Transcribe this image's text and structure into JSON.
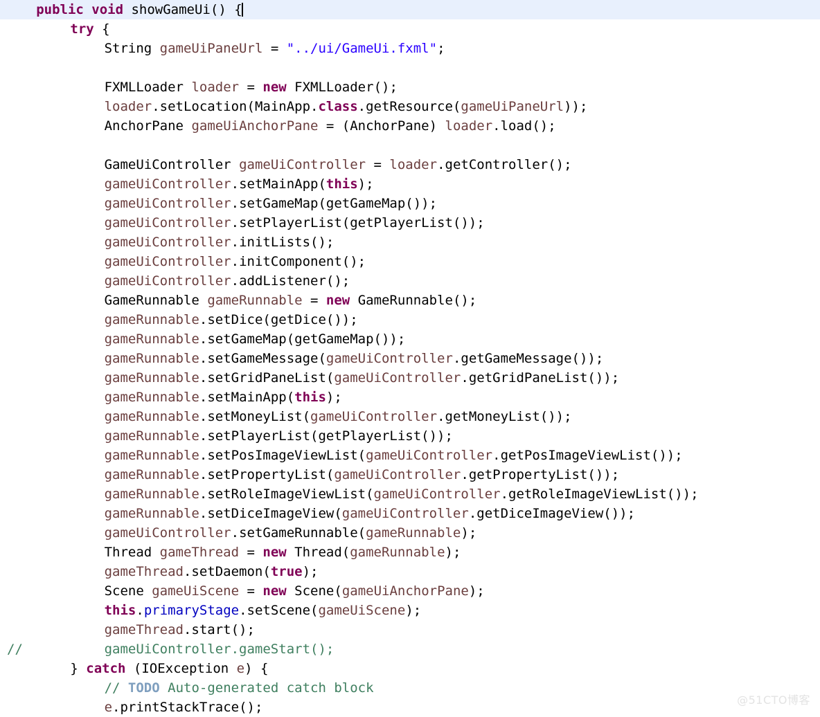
{
  "editor": {
    "language": "java",
    "font_size_px": 19,
    "line_height_px": 28,
    "current_line_index": 0,
    "caret_line": 0,
    "colors": {
      "background": "#ffffff",
      "current_line_highlight": "#e8f0fd",
      "keyword": "#7f0055",
      "type": "#000000",
      "local_variable": "#6a3e3e",
      "field": "#0000c0",
      "string": "#2a00ff",
      "comment": "#3f7f5f",
      "todo_tag": "#7f9fbf",
      "watermark": "#e3e3e3"
    }
  },
  "watermark": {
    "text": "@51CTO博客"
  },
  "code": {
    "lines": [
      {
        "indent": 4,
        "current": true,
        "caret_at_end": true,
        "tokens": [
          {
            "t": "kw",
            "s": "public"
          },
          {
            "t": "plain",
            "s": " "
          },
          {
            "t": "kw",
            "s": "void"
          },
          {
            "t": "plain",
            "s": " showGameUi() {"
          }
        ]
      },
      {
        "indent": 8,
        "tokens": [
          {
            "t": "kw",
            "s": "try"
          },
          {
            "t": "plain",
            "s": " {"
          }
        ]
      },
      {
        "indent": 12,
        "tokens": [
          {
            "t": "type",
            "s": "String "
          },
          {
            "t": "var",
            "s": "gameUiPaneUrl"
          },
          {
            "t": "plain",
            "s": " = "
          },
          {
            "t": "str",
            "s": "\"../ui/GameUi.fxml\""
          },
          {
            "t": "plain",
            "s": ";"
          }
        ]
      },
      {
        "indent": 0,
        "tokens": []
      },
      {
        "indent": 12,
        "tokens": [
          {
            "t": "type",
            "s": "FXMLLoader "
          },
          {
            "t": "var",
            "s": "loader"
          },
          {
            "t": "plain",
            "s": " = "
          },
          {
            "t": "kw",
            "s": "new"
          },
          {
            "t": "plain",
            "s": " FXMLLoader();"
          }
        ]
      },
      {
        "indent": 12,
        "tokens": [
          {
            "t": "var",
            "s": "loader"
          },
          {
            "t": "plain",
            "s": ".setLocation(MainApp."
          },
          {
            "t": "kw",
            "s": "class"
          },
          {
            "t": "plain",
            "s": ".getResource("
          },
          {
            "t": "var",
            "s": "gameUiPaneUrl"
          },
          {
            "t": "plain",
            "s": "));"
          }
        ]
      },
      {
        "indent": 12,
        "tokens": [
          {
            "t": "type",
            "s": "AnchorPane "
          },
          {
            "t": "var",
            "s": "gameUiAnchorPane"
          },
          {
            "t": "plain",
            "s": " = (AnchorPane) "
          },
          {
            "t": "var",
            "s": "loader"
          },
          {
            "t": "plain",
            "s": ".load();"
          }
        ]
      },
      {
        "indent": 0,
        "tokens": []
      },
      {
        "indent": 12,
        "tokens": [
          {
            "t": "type",
            "s": "GameUiController "
          },
          {
            "t": "var",
            "s": "gameUiController"
          },
          {
            "t": "plain",
            "s": " = "
          },
          {
            "t": "var",
            "s": "loader"
          },
          {
            "t": "plain",
            "s": ".getController();"
          }
        ]
      },
      {
        "indent": 12,
        "tokens": [
          {
            "t": "var",
            "s": "gameUiController"
          },
          {
            "t": "plain",
            "s": ".setMainApp("
          },
          {
            "t": "kw",
            "s": "this"
          },
          {
            "t": "plain",
            "s": ");"
          }
        ]
      },
      {
        "indent": 12,
        "tokens": [
          {
            "t": "var",
            "s": "gameUiController"
          },
          {
            "t": "plain",
            "s": ".setGameMap(getGameMap());"
          }
        ]
      },
      {
        "indent": 12,
        "tokens": [
          {
            "t": "var",
            "s": "gameUiController"
          },
          {
            "t": "plain",
            "s": ".setPlayerList(getPlayerList());"
          }
        ]
      },
      {
        "indent": 12,
        "tokens": [
          {
            "t": "var",
            "s": "gameUiController"
          },
          {
            "t": "plain",
            "s": ".initLists();"
          }
        ]
      },
      {
        "indent": 12,
        "tokens": [
          {
            "t": "var",
            "s": "gameUiController"
          },
          {
            "t": "plain",
            "s": ".initComponent();"
          }
        ]
      },
      {
        "indent": 12,
        "tokens": [
          {
            "t": "var",
            "s": "gameUiController"
          },
          {
            "t": "plain",
            "s": ".addListener();"
          }
        ]
      },
      {
        "indent": 12,
        "tokens": [
          {
            "t": "type",
            "s": "GameRunnable "
          },
          {
            "t": "var",
            "s": "gameRunnable"
          },
          {
            "t": "plain",
            "s": " = "
          },
          {
            "t": "kw",
            "s": "new"
          },
          {
            "t": "plain",
            "s": " GameRunnable();"
          }
        ]
      },
      {
        "indent": 12,
        "tokens": [
          {
            "t": "var",
            "s": "gameRunnable"
          },
          {
            "t": "plain",
            "s": ".setDice(getDice());"
          }
        ]
      },
      {
        "indent": 12,
        "tokens": [
          {
            "t": "var",
            "s": "gameRunnable"
          },
          {
            "t": "plain",
            "s": ".setGameMap(getGameMap());"
          }
        ]
      },
      {
        "indent": 12,
        "tokens": [
          {
            "t": "var",
            "s": "gameRunnable"
          },
          {
            "t": "plain",
            "s": ".setGameMessage("
          },
          {
            "t": "var",
            "s": "gameUiController"
          },
          {
            "t": "plain",
            "s": ".getGameMessage());"
          }
        ]
      },
      {
        "indent": 12,
        "tokens": [
          {
            "t": "var",
            "s": "gameRunnable"
          },
          {
            "t": "plain",
            "s": ".setGridPaneList("
          },
          {
            "t": "var",
            "s": "gameUiController"
          },
          {
            "t": "plain",
            "s": ".getGridPaneList());"
          }
        ]
      },
      {
        "indent": 12,
        "tokens": [
          {
            "t": "var",
            "s": "gameRunnable"
          },
          {
            "t": "plain",
            "s": ".setMainApp("
          },
          {
            "t": "kw",
            "s": "this"
          },
          {
            "t": "plain",
            "s": ");"
          }
        ]
      },
      {
        "indent": 12,
        "tokens": [
          {
            "t": "var",
            "s": "gameRunnable"
          },
          {
            "t": "plain",
            "s": ".setMoneyList("
          },
          {
            "t": "var",
            "s": "gameUiController"
          },
          {
            "t": "plain",
            "s": ".getMoneyList());"
          }
        ]
      },
      {
        "indent": 12,
        "tokens": [
          {
            "t": "var",
            "s": "gameRunnable"
          },
          {
            "t": "plain",
            "s": ".setPlayerList(getPlayerList());"
          }
        ]
      },
      {
        "indent": 12,
        "tokens": [
          {
            "t": "var",
            "s": "gameRunnable"
          },
          {
            "t": "plain",
            "s": ".setPosImageViewList("
          },
          {
            "t": "var",
            "s": "gameUiController"
          },
          {
            "t": "plain",
            "s": ".getPosImageViewList());"
          }
        ]
      },
      {
        "indent": 12,
        "tokens": [
          {
            "t": "var",
            "s": "gameRunnable"
          },
          {
            "t": "plain",
            "s": ".setPropertyList("
          },
          {
            "t": "var",
            "s": "gameUiController"
          },
          {
            "t": "plain",
            "s": ".getPropertyList());"
          }
        ]
      },
      {
        "indent": 12,
        "tokens": [
          {
            "t": "var",
            "s": "gameRunnable"
          },
          {
            "t": "plain",
            "s": ".setRoleImageViewList("
          },
          {
            "t": "var",
            "s": "gameUiController"
          },
          {
            "t": "plain",
            "s": ".getRoleImageViewList());"
          }
        ]
      },
      {
        "indent": 12,
        "tokens": [
          {
            "t": "var",
            "s": "gameRunnable"
          },
          {
            "t": "plain",
            "s": ".setDiceImageView("
          },
          {
            "t": "var",
            "s": "gameUiController"
          },
          {
            "t": "plain",
            "s": ".getDiceImageView());"
          }
        ]
      },
      {
        "indent": 12,
        "tokens": [
          {
            "t": "var",
            "s": "gameUiController"
          },
          {
            "t": "plain",
            "s": ".setGameRunnable("
          },
          {
            "t": "var",
            "s": "gameRunnable"
          },
          {
            "t": "plain",
            "s": ");"
          }
        ]
      },
      {
        "indent": 12,
        "tokens": [
          {
            "t": "type",
            "s": "Thread "
          },
          {
            "t": "var",
            "s": "gameThread"
          },
          {
            "t": "plain",
            "s": " = "
          },
          {
            "t": "kw",
            "s": "new"
          },
          {
            "t": "plain",
            "s": " Thread("
          },
          {
            "t": "var",
            "s": "gameRunnable"
          },
          {
            "t": "plain",
            "s": ");"
          }
        ]
      },
      {
        "indent": 12,
        "tokens": [
          {
            "t": "var",
            "s": "gameThread"
          },
          {
            "t": "plain",
            "s": ".setDaemon("
          },
          {
            "t": "kw",
            "s": "true"
          },
          {
            "t": "plain",
            "s": ");"
          }
        ]
      },
      {
        "indent": 12,
        "tokens": [
          {
            "t": "type",
            "s": "Scene "
          },
          {
            "t": "var",
            "s": "gameUiScene"
          },
          {
            "t": "plain",
            "s": " = "
          },
          {
            "t": "kw",
            "s": "new"
          },
          {
            "t": "plain",
            "s": " Scene("
          },
          {
            "t": "var",
            "s": "gameUiAnchorPane"
          },
          {
            "t": "plain",
            "s": ");"
          }
        ]
      },
      {
        "indent": 12,
        "tokens": [
          {
            "t": "kw",
            "s": "this"
          },
          {
            "t": "plain",
            "s": "."
          },
          {
            "t": "field",
            "s": "primaryStage"
          },
          {
            "t": "plain",
            "s": ".setScene("
          },
          {
            "t": "var",
            "s": "gameUiScene"
          },
          {
            "t": "plain",
            "s": ");"
          }
        ]
      },
      {
        "indent": 12,
        "tokens": [
          {
            "t": "var",
            "s": "gameThread"
          },
          {
            "t": "plain",
            "s": ".start();"
          }
        ]
      },
      {
        "indent": 12,
        "gutter_comment": "//",
        "tokens": [
          {
            "t": "cmt",
            "s": "gameUiController.gameStart();"
          }
        ]
      },
      {
        "indent": 8,
        "tokens": [
          {
            "t": "plain",
            "s": "} "
          },
          {
            "t": "kw",
            "s": "catch"
          },
          {
            "t": "plain",
            "s": " (IOException "
          },
          {
            "t": "var",
            "s": "e"
          },
          {
            "t": "plain",
            "s": ") {"
          }
        ]
      },
      {
        "indent": 12,
        "tokens": [
          {
            "t": "cmt",
            "s": "// "
          },
          {
            "t": "todo",
            "s": "TODO"
          },
          {
            "t": "cmt",
            "s": " Auto-generated catch block"
          }
        ]
      },
      {
        "indent": 12,
        "tokens": [
          {
            "t": "var",
            "s": "e"
          },
          {
            "t": "plain",
            "s": ".printStackTrace();"
          }
        ]
      }
    ]
  }
}
